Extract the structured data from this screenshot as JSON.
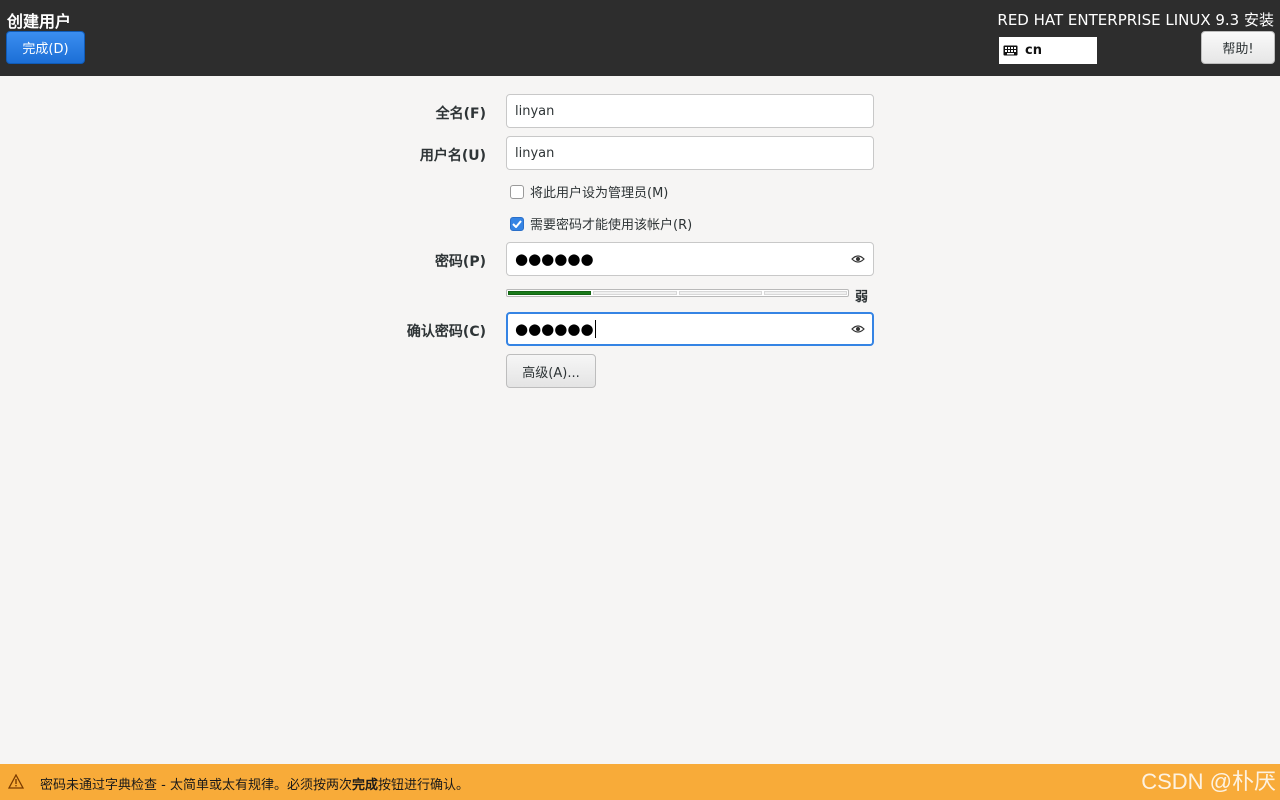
{
  "header": {
    "page_title": "创建用户",
    "done_label": "完成(D)",
    "product_title": "RED HAT ENTERPRISE LINUX 9.3 安装",
    "keyboard_layout": "cn",
    "help_label": "帮助!"
  },
  "form": {
    "fullname_label": "全名(F)",
    "fullname_value": "linyan",
    "username_label": "用户名(U)",
    "username_value": "linyan",
    "admin_checkbox_label": "将此用户设为管理员(M)",
    "admin_checked": false,
    "require_password_label": "需要密码才能使用该帐户(R)",
    "require_password_checked": true,
    "password_label": "密码(P)",
    "password_mask": "●●●●●●",
    "strength_level": 1,
    "strength_segments": 4,
    "strength_label": "弱",
    "confirm_label": "确认密码(C)",
    "confirm_mask": "●●●●●●",
    "advanced_label": "高级(A)..."
  },
  "status": {
    "pre": "密码未通过字典检查 - 太简单或太有规律。必须按两次",
    "bold": "完成",
    "post": "按钮进行确认。",
    "watermark": "CSDN @朴厌"
  },
  "colors": {
    "header_bg": "#2d2d2d",
    "accent": "#3584e4",
    "strength_on": "#1a7a1a",
    "warning_bg": "#f8ab39"
  }
}
